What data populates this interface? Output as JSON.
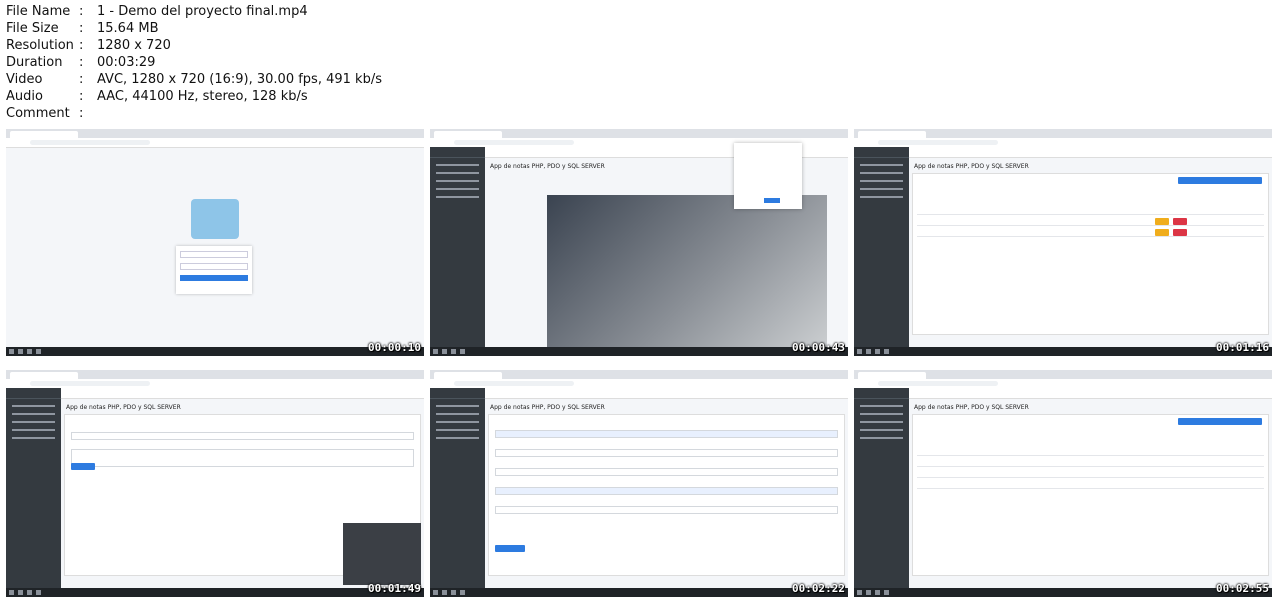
{
  "info": [
    {
      "key": "File Name",
      "sep": ":",
      "value": "1 - Demo del proyecto final.mp4"
    },
    {
      "key": "File Size",
      "sep": ":",
      "value": "15.64 MB"
    },
    {
      "key": "Resolution",
      "sep": ":",
      "value": "1280 x 720"
    },
    {
      "key": "Duration",
      "sep": ":",
      "value": "00:03:29"
    },
    {
      "key": "Video",
      "sep": ":",
      "value": "AVC, 1280 x 720 (16:9), 30.00 fps, 491 kb/s"
    },
    {
      "key": "Audio",
      "sep": ":",
      "value": "AAC, 44100 Hz, stereo, 128 kb/s"
    },
    {
      "key": "Comment",
      "sep": ":",
      "value": ""
    }
  ],
  "thumbnails": [
    {
      "timestamp": "00:00:10"
    },
    {
      "timestamp": "00:00:43",
      "page_title": "App de notas PHP, PDO y SQL SERVER"
    },
    {
      "timestamp": "00:01:16",
      "page_title": "App de notas PHP, PDO y SQL SERVER"
    },
    {
      "timestamp": "00:01:49",
      "page_title": "App de notas PHP, PDO y SQL SERVER"
    },
    {
      "timestamp": "00:02:22",
      "page_title": "App de notas PHP, PDO y SQL SERVER"
    },
    {
      "timestamp": "00:02:55",
      "page_title": "App de notas PHP, PDO y SQL SERVER"
    }
  ]
}
